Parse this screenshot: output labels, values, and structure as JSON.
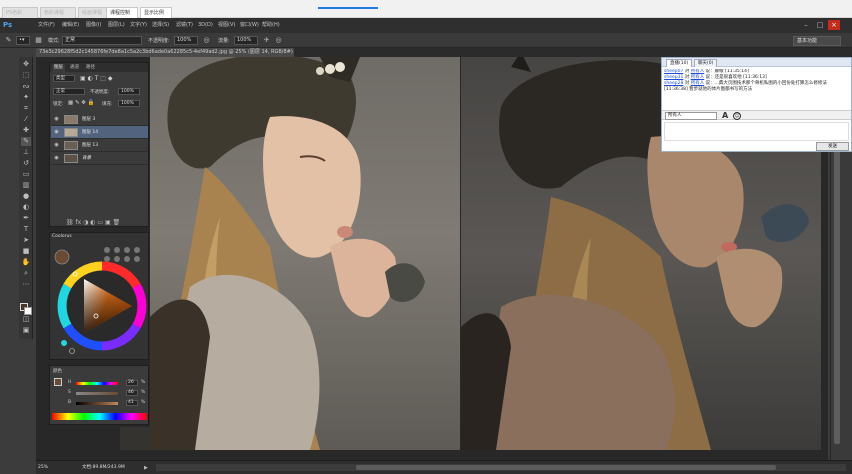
{
  "browser_tabs": [
    {
      "label": "PS色彩",
      "active": false
    },
    {
      "label": "色彩课程",
      "active": false
    },
    {
      "label": "绘画课程",
      "active": false
    },
    {
      "label": "课程控制",
      "active": true
    },
    {
      "label": "显示比例",
      "active": true
    }
  ],
  "menubar": {
    "logo": "Ps",
    "items": [
      "文件(F)",
      "编辑(E)",
      "图像(I)",
      "图层(L)",
      "文字(Y)",
      "选择(S)",
      "滤镜(T)",
      "3D(D)",
      "视图(V)",
      "窗口(W)",
      "帮助(H)"
    ],
    "window_controls": {
      "minimize": "–",
      "maximize": "□",
      "close": "×"
    }
  },
  "options_bar": {
    "mode_label": "模式:",
    "mode_value": "正常",
    "opacity_label": "不透明度:",
    "opacity_value": "100%",
    "flow_label": "流量:",
    "flow_value": "100%",
    "workspace": "基本功能"
  },
  "document_tab": {
    "title": "73e3c29628f5d2c145876fe7de8a1c5a2c3bd6ade0a62285c5-4ef49ad2.jpg @ 25% (图层 14, RGB/8#) *"
  },
  "layers_panel": {
    "tabs": [
      "图层",
      "通道",
      "路径"
    ],
    "kind_label": "类型",
    "blend_mode": "正常",
    "opacity_label": "不透明度:",
    "opacity_value": "100%",
    "lock_label": "锁定:",
    "fill_label": "填充:",
    "fill_value": "100%",
    "layers": [
      {
        "name": "图层 3",
        "selected": false,
        "thumb": "#8a7a6a"
      },
      {
        "name": "图层 14",
        "selected": true,
        "thumb": "#b8a896"
      },
      {
        "name": "图层 13",
        "selected": false,
        "thumb": "#6a5f54"
      },
      {
        "name": "背景",
        "selected": false,
        "thumb": "#5c5047"
      }
    ]
  },
  "color_panel": {
    "title": "Coolorus",
    "current_color": "#6b4a35"
  },
  "slider_panel": {
    "title": "颜色",
    "sliders": [
      {
        "label": "H",
        "value": "26"
      },
      {
        "label": "S",
        "value": "46"
      },
      {
        "label": "B",
        "value": "41"
      }
    ],
    "percent": "%"
  },
  "chat": {
    "tabs": [
      {
        "label": "直播(10)",
        "active": true
      },
      {
        "label": "聊天(0)",
        "active": false
      }
    ],
    "messages": [
      {
        "user": "sheep07",
        "to": "所有人",
        "text": "说：藤椒 [11:35:14]"
      },
      {
        "user": "sheep31",
        "to": "所有人",
        "text": "说：还是很喜欢他 [11:36:13]"
      },
      {
        "user": "sheep28",
        "to": "所有人",
        "text": "说：...典大页图技术那个骨机私图的小回份处打算怎么修修法"
      },
      {
        "user": "",
        "to": "",
        "text": "[11:36:38] 暂步就他的体片图都书写的方法"
      }
    ],
    "recipient": "所有人",
    "font_icon": "A",
    "send_label": "发送"
  },
  "status_bar": {
    "zoom": "25%",
    "doc_info": "文档:89.8M/243.9M",
    "arrow": "▶"
  },
  "colors": {
    "accent_blue": "#1e7ae0",
    "selected_layer": "#52647d",
    "close_red": "#c42b1c"
  }
}
